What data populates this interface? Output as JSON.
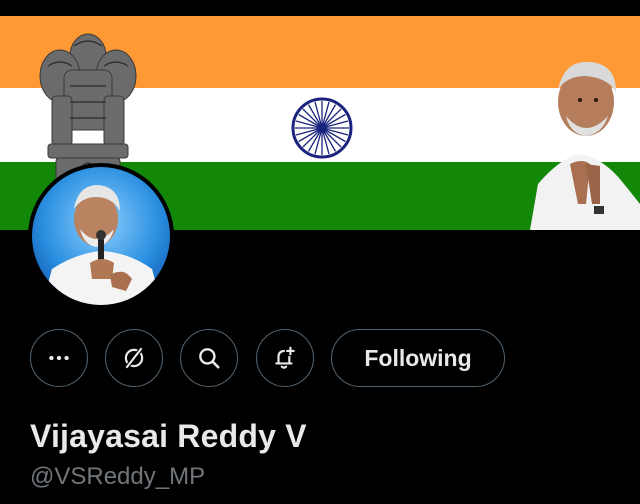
{
  "profile": {
    "display_name": "Vijayasai Reddy V",
    "handle": "@VSReddy_MP"
  },
  "actions": {
    "more_icon": "more-dots-icon",
    "grok_icon": "grok-slash-icon",
    "search_icon": "search-icon",
    "notify_icon": "bell-add-icon",
    "follow_label": "Following"
  },
  "banner": {
    "flag_colors": {
      "saffron": "#ff9933",
      "white": "#ffffff",
      "green": "#138808",
      "chakra": "#1a237e"
    }
  },
  "colors": {
    "background": "#000000",
    "text_primary": "#e7e9ea",
    "text_secondary": "#71767b",
    "border": "#536471"
  }
}
